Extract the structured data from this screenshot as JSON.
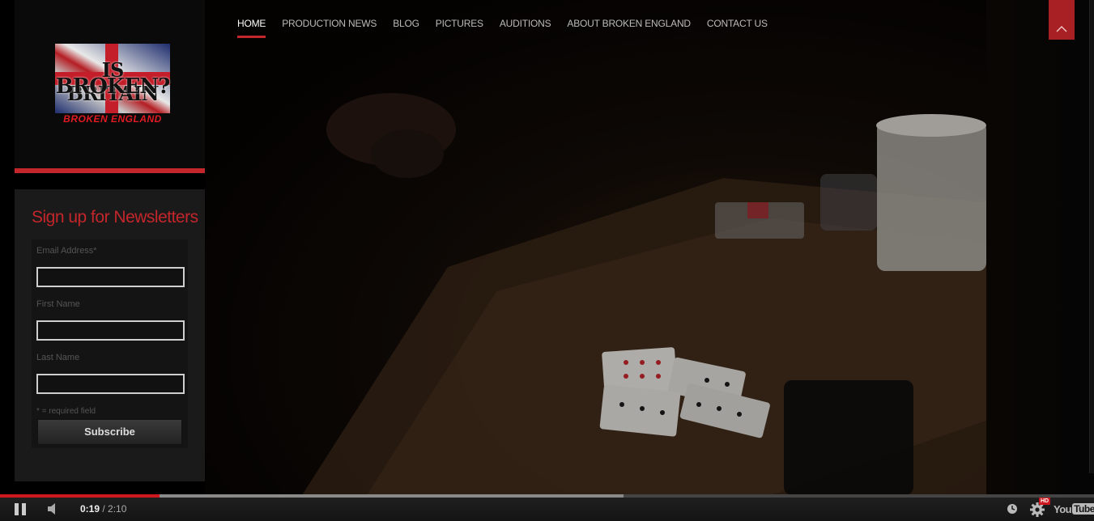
{
  "site": {
    "logo_line1": "IS BRITAIN",
    "logo_line2": "BROKEN?",
    "logo_subtitle": "BROKEN ENGLAND",
    "accent_color": "#c3262b"
  },
  "nav": {
    "items": [
      {
        "label": "HOME",
        "active": true
      },
      {
        "label": "PRODUCTION NEWS"
      },
      {
        "label": "BLOG"
      },
      {
        "label": "PICTURES"
      },
      {
        "label": "AUDITIONS"
      },
      {
        "label": "ABOUT BROKEN ENGLAND"
      },
      {
        "label": "CONTACT US"
      }
    ],
    "top_button_icon": "chevron-up-icon"
  },
  "newsletter": {
    "title": "Sign up for Newsletters",
    "email_label": "Email Address*",
    "email_value": "",
    "first_name_label": "First Name",
    "first_name_value": "",
    "last_name_label": "Last Name",
    "last_name_value": "",
    "required_note": "* = required field",
    "subscribe_label": "Subscribe"
  },
  "video": {
    "current_time": "0:19",
    "separator": " / ",
    "duration": "2:10",
    "played_fraction": 0.146,
    "buffered_fraction": 0.57,
    "quality_badge": "HD",
    "brand_you": "You",
    "brand_tube": "Tube",
    "icons": [
      "pause-icon",
      "volume-icon",
      "watch-later-icon",
      "settings-gear-icon",
      "youtube-logo"
    ]
  }
}
